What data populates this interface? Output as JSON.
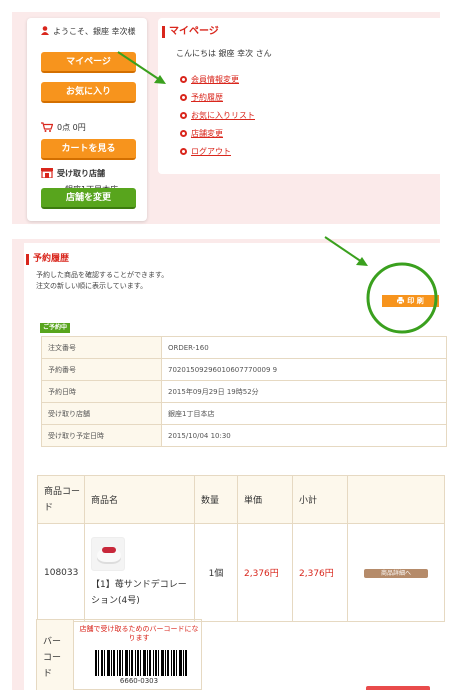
{
  "sidebar": {
    "welcome": "ようこそ、銀座 幸次様",
    "mypage_button": "マイページ",
    "favorites_button": "お気に入り",
    "cart_status": "0点  0円",
    "view_cart_button": "カートを見る",
    "pickup_store_label": "受け取り店舗",
    "pickup_store_name": "銀座1丁目本店",
    "change_store_button": "店舗を変更"
  },
  "mypage": {
    "title": "マイページ",
    "greeting": "こんにちは 銀座 幸次 さん",
    "links": [
      "会員情報変更",
      "予約履歴",
      "お気に入りリスト",
      "店舗変更",
      "ログアウト"
    ]
  },
  "reservation": {
    "title": "予約履歴",
    "desc_line1": "予約した商品を確認することができます。",
    "desc_line2": "注文の新しい順に表示しています。",
    "print_button": "印 刷",
    "status_badge": "ご予約中",
    "fields": [
      {
        "label": "注文番号",
        "value": "ORDER-160"
      },
      {
        "label": "予約番号",
        "value": "70201509296010607770009 9"
      },
      {
        "label": "予約日時",
        "value": "2015年09月29日 19時52分"
      },
      {
        "label": "受け取り店舗",
        "value": "銀座1丁目本店"
      },
      {
        "label": "受け取り予定日時",
        "value": "2015/10/04 10:30"
      }
    ],
    "items_headers": {
      "code": "商品コード",
      "name": "商品名",
      "qty": "数量",
      "unit_price": "単価",
      "subtotal": "小計"
    },
    "item": {
      "code": "108033",
      "name": "【1】苺サンドデコレーション(4号)",
      "qty": "1個",
      "unit_price": "2,376円",
      "subtotal": "2,376円",
      "detail_button": "商品詳細へ"
    },
    "barcode": {
      "label": "バーコード",
      "note": "店舗で受け取るためのバーコードになります",
      "number": "6660-0303"
    }
  },
  "colors": {
    "accent_red": "#d9261c",
    "orange": "#f7941d",
    "green": "#58a51d",
    "annotation_green": "#3aa01e"
  }
}
